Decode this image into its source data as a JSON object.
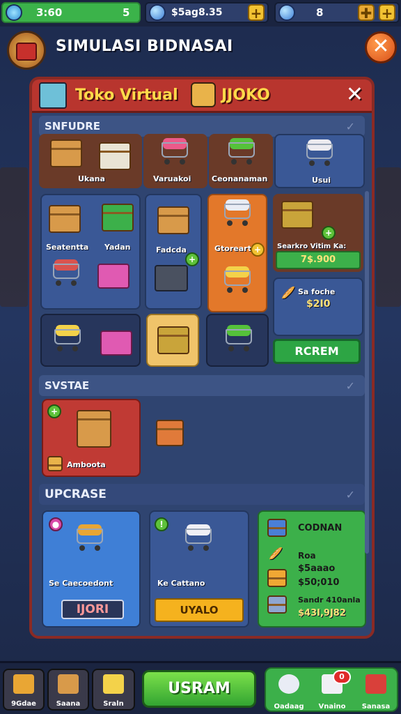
{
  "topbar": {
    "res1_value": "3:60",
    "res1_count": "5",
    "res2_value": "$5ag8.35",
    "res3_value": "8"
  },
  "header": {
    "title": "SIMULASI BIDNASAI"
  },
  "store": {
    "title": "Toko Virtual",
    "shop_name": "JJOKO",
    "sections": [
      {
        "label": "SNFUDRE"
      },
      {
        "label": "SVSTAE"
      },
      {
        "label": "UPCRASE"
      }
    ],
    "row1": [
      "Ukana",
      "Varuakoi",
      "Ceonanaman",
      "Usui"
    ],
    "grid": {
      "a1": "Seatentta",
      "a2": "Yadan",
      "b1": "Fadcda",
      "c1": "Gtoreart",
      "d_title": "Searkro Vitim Ka:",
      "d_price": "7$.900",
      "e_title": "Sa foche",
      "e_price": "$2I0",
      "buy_button": "RCREM"
    },
    "featured": {
      "label": "Amboota"
    },
    "upgrade": {
      "card1_label": "Se Caecoedont",
      "card1_button": "IJORI",
      "card2_label": "Ke Cattano",
      "card2_button": "UYALO",
      "card3_title": "CODNAN",
      "card3_line1": "Roa",
      "card3_line2": "$5aaao",
      "card3_line3": "$50;010",
      "card3_line4": "Sandr 410anla",
      "card3_line5": "$43I,9J82"
    }
  },
  "bottom_nav": {
    "left": [
      "9Gdae",
      "Saana",
      "Sraln"
    ],
    "center": "USRAM",
    "right": [
      "Oadaag",
      "Vnaino",
      "Sanasa"
    ],
    "notif": "0"
  },
  "colors": {
    "accent_green": "#3cb04a",
    "panel_red": "#b8352e",
    "panel_blue": "#2f4470",
    "gold": "#ffd94a"
  }
}
